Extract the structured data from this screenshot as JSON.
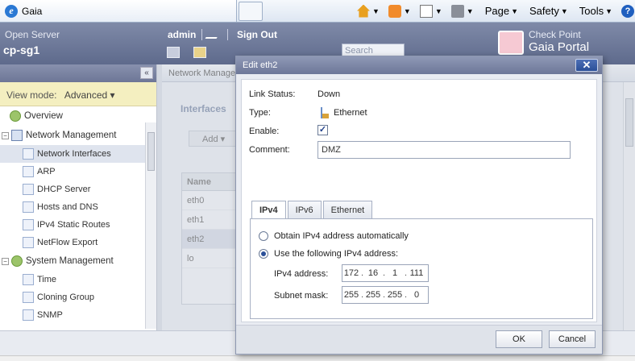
{
  "browser": {
    "tab_title": "Gaia",
    "menus": [
      "Page",
      "Safety",
      "Tools"
    ]
  },
  "header": {
    "product": "Open Server",
    "hostname": "cp-sg1",
    "user": "admin",
    "sign_out": "Sign Out",
    "search_placeholder": "Search",
    "brand_top": "Check Point",
    "brand_bottom": "Gaia Portal"
  },
  "nav": {
    "view_mode_label": "View mode:",
    "view_mode_value": "Advanced",
    "overview": "Overview",
    "network_management": "Network Management",
    "network_items": [
      "Network Interfaces",
      "ARP",
      "DHCP Server",
      "Hosts and DNS",
      "IPv4 Static Routes",
      "NetFlow Export"
    ],
    "system_management": "System Management",
    "system_items": [
      "Time",
      "Cloning Group",
      "SNMP"
    ]
  },
  "main": {
    "breadcrumb": "Network Manage",
    "title": "Interfaces",
    "add_label": "Add",
    "table_header": "Name",
    "rows": [
      "eth0",
      "eth1",
      "eth2",
      "lo"
    ]
  },
  "dialog": {
    "title": "Edit eth2",
    "close": "✕",
    "link_status_label": "Link Status:",
    "link_status_value": "Down",
    "type_label": "Type:",
    "type_value": "Ethernet",
    "enable_label": "Enable:",
    "enable_checked": "✓",
    "comment_label": "Comment:",
    "comment_value": "DMZ",
    "tabs": [
      "IPv4",
      "IPv6",
      "Ethernet"
    ],
    "auto_option": "Obtain IPv4 address automatically",
    "manual_option": "Use the following IPv4 address:",
    "ip_label": "IPv4 address:",
    "ip": [
      "172",
      "16",
      "1",
      "111"
    ],
    "mask_label": "Subnet mask:",
    "mask": [
      "255",
      "255",
      "255",
      "0"
    ],
    "ok": "OK",
    "cancel": "Cancel"
  }
}
